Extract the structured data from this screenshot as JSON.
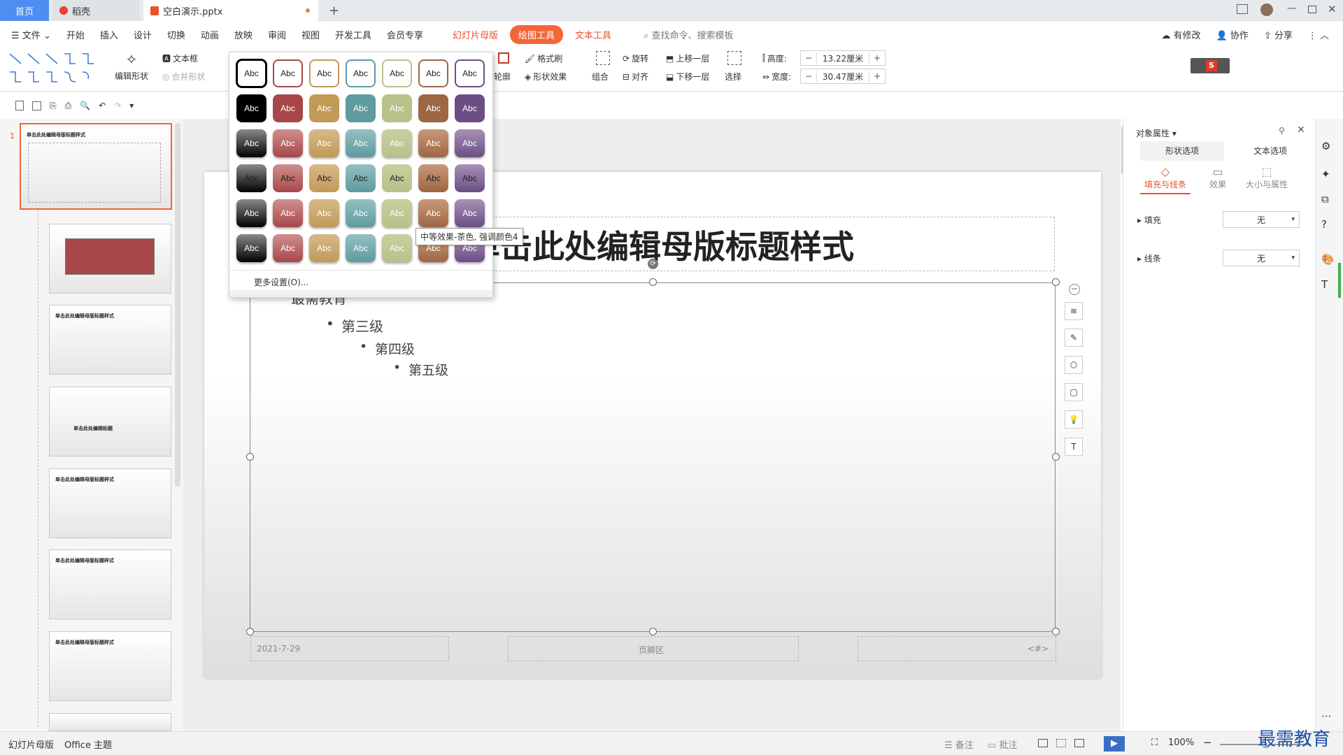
{
  "tabs": {
    "home": "首页",
    "docer": "稻壳",
    "file": "空白演示.pptx",
    "new": "+"
  },
  "menu": {
    "file": "文件",
    "items": [
      "开始",
      "插入",
      "设计",
      "切换",
      "动画",
      "放映",
      "审阅",
      "视图",
      "开发工具",
      "会员专享"
    ],
    "ctx_master": "幻灯片母版",
    "ctx_draw": "绘图工具",
    "ctx_text": "文本工具",
    "search": "查找命令、搜索模板",
    "modified": "有修改",
    "collab": "协作",
    "share": "分享"
  },
  "ribbon": {
    "edit_shape": "编辑形状",
    "textbox": "文本框",
    "merge": "合并形状",
    "outline": "轮廓",
    "format_painter": "格式刷",
    "shape_effect": "形状效果",
    "rotate": "旋转",
    "group": "组合",
    "align": "对齐",
    "up": "上移一层",
    "down": "下移一层",
    "select": "选择",
    "height_label": "高度:",
    "height": "13.22厘米",
    "width_label": "宽度:",
    "width": "30.47厘米"
  },
  "gallery": {
    "sample": "Abc",
    "more": "更多设置(O)...",
    "tooltip": "中等效果-茶色, 强调颜色4",
    "colors": [
      "#000000",
      "#a8474a",
      "#c19a58",
      "#5f9b9f",
      "#b9c08a",
      "#9e6744",
      "#6b4e86"
    ],
    "tints": [
      "#8a8a8a",
      "#cf8f8e",
      "#d9b889",
      "#95c0c2",
      "#c9cf9f",
      "#c89879",
      "#a891b6"
    ]
  },
  "slide": {
    "title": "单击此处编辑母版标题样式",
    "body_partial": "最需教育",
    "level3": "第三级",
    "level4": "第四级",
    "level5": "第五级",
    "date": "2021-7-29",
    "footer": "页脚区",
    "page": "<#>"
  },
  "thumbs": {
    "num": "1",
    "title": "单击此处编辑母版标题样式",
    "title_short": "单击此处编辑标题"
  },
  "panel": {
    "header": "对象属性",
    "tab_shape": "形状选项",
    "tab_text": "文本选项",
    "fill_line": "填充与线条",
    "effect": "效果",
    "size_prop": "大小与属性",
    "fill": "填充",
    "fill_value": "无",
    "line": "线条",
    "line_value": "无"
  },
  "status": {
    "mode": "幻灯片母版",
    "theme": "Office 主题",
    "notes": "备注",
    "comments": "批注",
    "zoom": "100%"
  },
  "watermark": "最需教育"
}
